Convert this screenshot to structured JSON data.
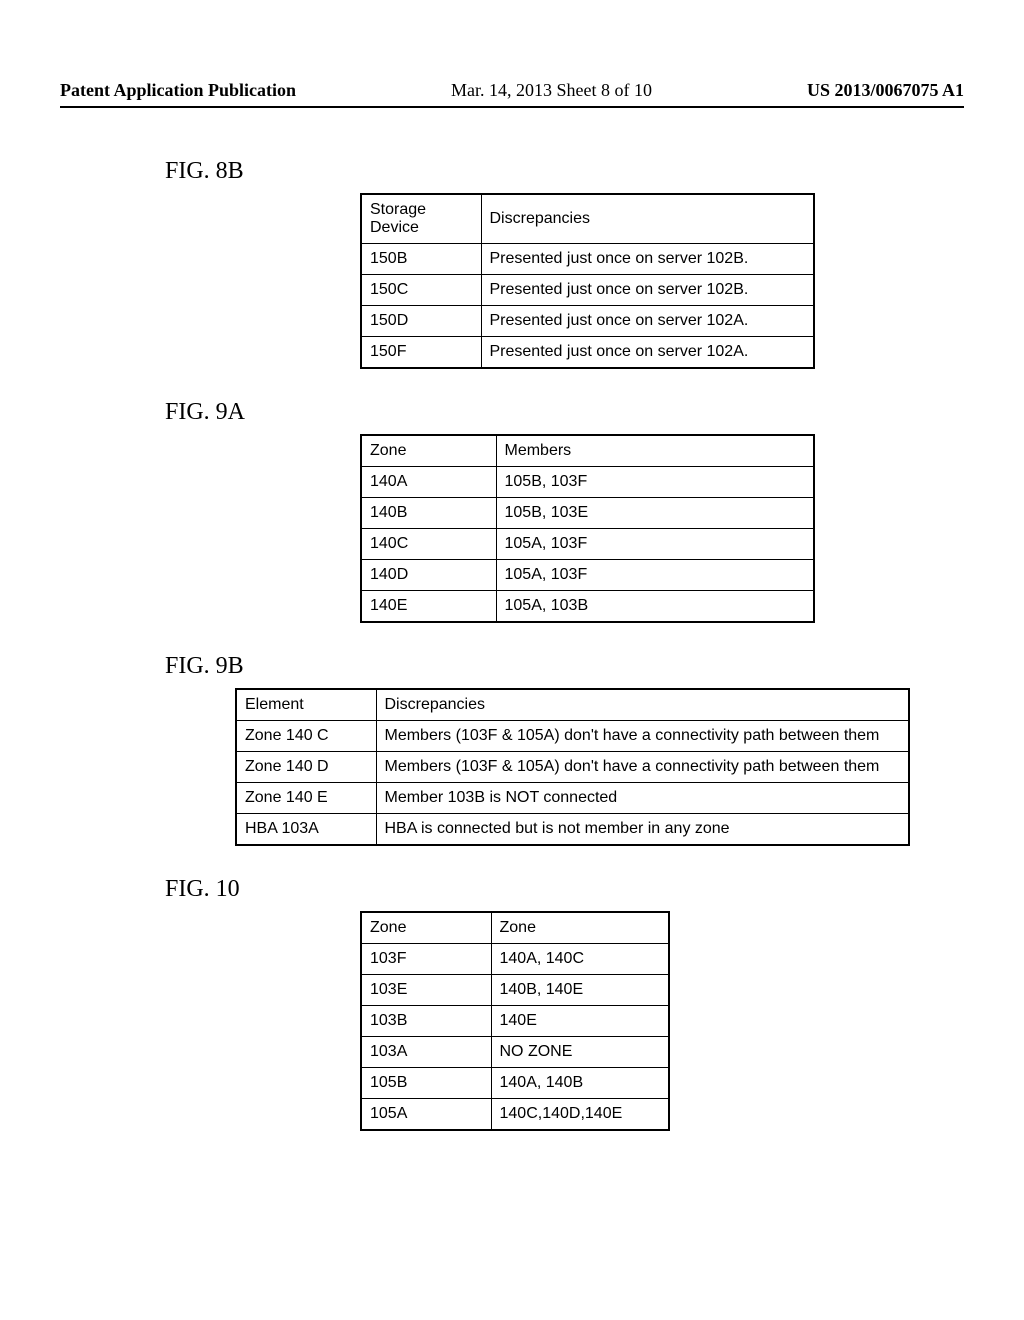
{
  "header": {
    "left": "Patent Application Publication",
    "center": "Mar. 14, 2013  Sheet 8 of 10",
    "right": "US 2013/0067075 A1"
  },
  "fig8b": {
    "label": "FIG. 8B",
    "headers": [
      "Storage Device",
      "Discrepancies"
    ],
    "rows": [
      [
        "150B",
        "Presented just once on server 102B."
      ],
      [
        "150C",
        "Presented just once on server 102B."
      ],
      [
        "150D",
        "Presented just once on server 102A."
      ],
      [
        "150F",
        "Presented just once on server 102A."
      ]
    ]
  },
  "fig9a": {
    "label": "FIG. 9A",
    "headers": [
      "Zone",
      "Members"
    ],
    "rows": [
      [
        "140A",
        "105B, 103F"
      ],
      [
        "140B",
        "105B, 103E"
      ],
      [
        "140C",
        "105A, 103F"
      ],
      [
        "140D",
        "105A, 103F"
      ],
      [
        "140E",
        "105A, 103B"
      ]
    ]
  },
  "fig9b": {
    "label": "FIG. 9B",
    "headers": [
      "Element",
      "Discrepancies"
    ],
    "rows": [
      [
        "Zone 140 C",
        "Members (103F & 105A) don't have a connectivity path between them"
      ],
      [
        "Zone 140 D",
        "Members (103F & 105A) don't have a connectivity path between them"
      ],
      [
        "Zone 140 E",
        "Member 103B is NOT connected"
      ],
      [
        "HBA 103A",
        "HBA is connected but is not member in any zone"
      ]
    ]
  },
  "fig10": {
    "label": "FIG. 10",
    "headers": [
      "Zone",
      "Zone"
    ],
    "rows": [
      [
        "103F",
        "140A, 140C"
      ],
      [
        "103E",
        "140B, 140E"
      ],
      [
        "103B",
        "140E"
      ],
      [
        "103A",
        "NO ZONE"
      ],
      [
        "105B",
        "140A, 140B"
      ],
      [
        "105A",
        "140C,140D,140E"
      ]
    ]
  }
}
